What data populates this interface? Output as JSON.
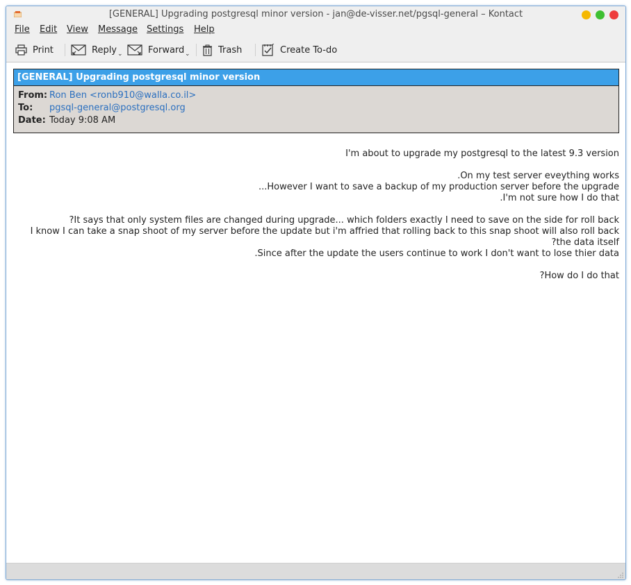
{
  "window": {
    "title": "[GENERAL] Upgrading postgresql minor version - jan@de-visser.net/pgsql-general – Kontact"
  },
  "menu": [
    {
      "label": "File",
      "name": "menu-file"
    },
    {
      "label": "Edit",
      "name": "menu-edit"
    },
    {
      "label": "View",
      "name": "menu-view"
    },
    {
      "label": "Message",
      "name": "menu-message"
    },
    {
      "label": "Settings",
      "name": "menu-settings"
    },
    {
      "label": "Help",
      "name": "menu-help"
    }
  ],
  "toolbar": {
    "print_label": "Print",
    "reply_label": "Reply",
    "forward_label": "Forward",
    "trash_label": "Trash",
    "todo_label": "Create To-do"
  },
  "message": {
    "subject": "[GENERAL] Upgrading postgresql minor version",
    "from_label": "From:",
    "from_value": "Ron Ben <ronb910@walla.co.il>",
    "to_label": "To:",
    "to_value": "pgsql-general@postgresql.org",
    "date_label": "Date:",
    "date_value": "Today 9:08 AM",
    "body_lines": [
      "I'm about to upgrade my postgresql to the latest 9.3 version",
      "",
      "On my test server eveything works.",
      "However I want to save a backup of my production server before the upgrade...",
      "I'm not sure how I do that.",
      "",
      "It says that only system files are changed during upgrade... which folders exactly I need to save on the side for roll back?",
      "I know I can take a snap shoot of my server before the update but i'm affried that rolling back to this snap shoot will also roll back",
      "the data itself?",
      "Since after the update the users continue to work I don't want to lose thier data.",
      "",
      "How do I do that?"
    ]
  }
}
